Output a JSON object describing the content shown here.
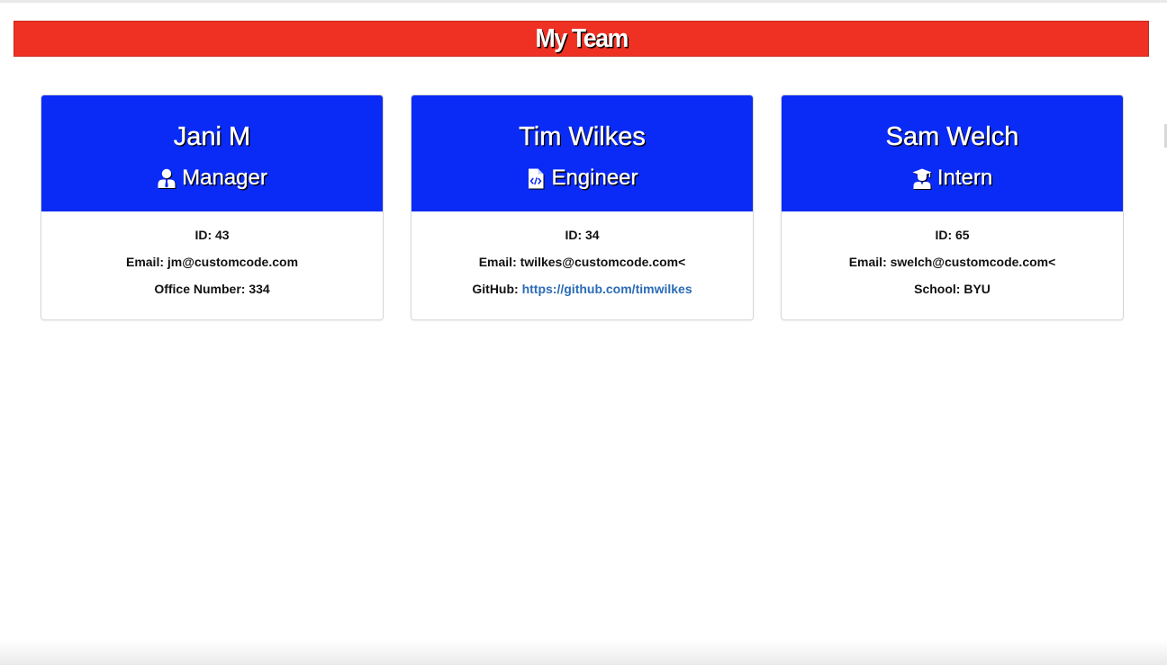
{
  "header": {
    "title": "My Team",
    "background_color": "#ee3123"
  },
  "card_header_color": "#0a2bf5",
  "link_color": "#2a6bb5",
  "team": [
    {
      "name": "Jani M",
      "role": "Manager",
      "role_icon": "user-tie-icon",
      "id_line": "ID: 43",
      "email_line": "Email: jm@customcode.com",
      "extra_label": "Office Number: 334",
      "extra_value": ""
    },
    {
      "name": "Tim Wilkes",
      "role": "Engineer",
      "role_icon": "file-code-icon",
      "id_line": "ID: 34",
      "email_line": "Email: twilkes@customcode.com<",
      "extra_label": "GitHub: ",
      "extra_value": "https://github.com/timwilkes"
    },
    {
      "name": "Sam Welch",
      "role": "Intern",
      "role_icon": "user-graduate-icon",
      "id_line": "ID: 65",
      "email_line": "Email: swelch@customcode.com<",
      "extra_label": "School: BYU",
      "extra_value": ""
    }
  ]
}
